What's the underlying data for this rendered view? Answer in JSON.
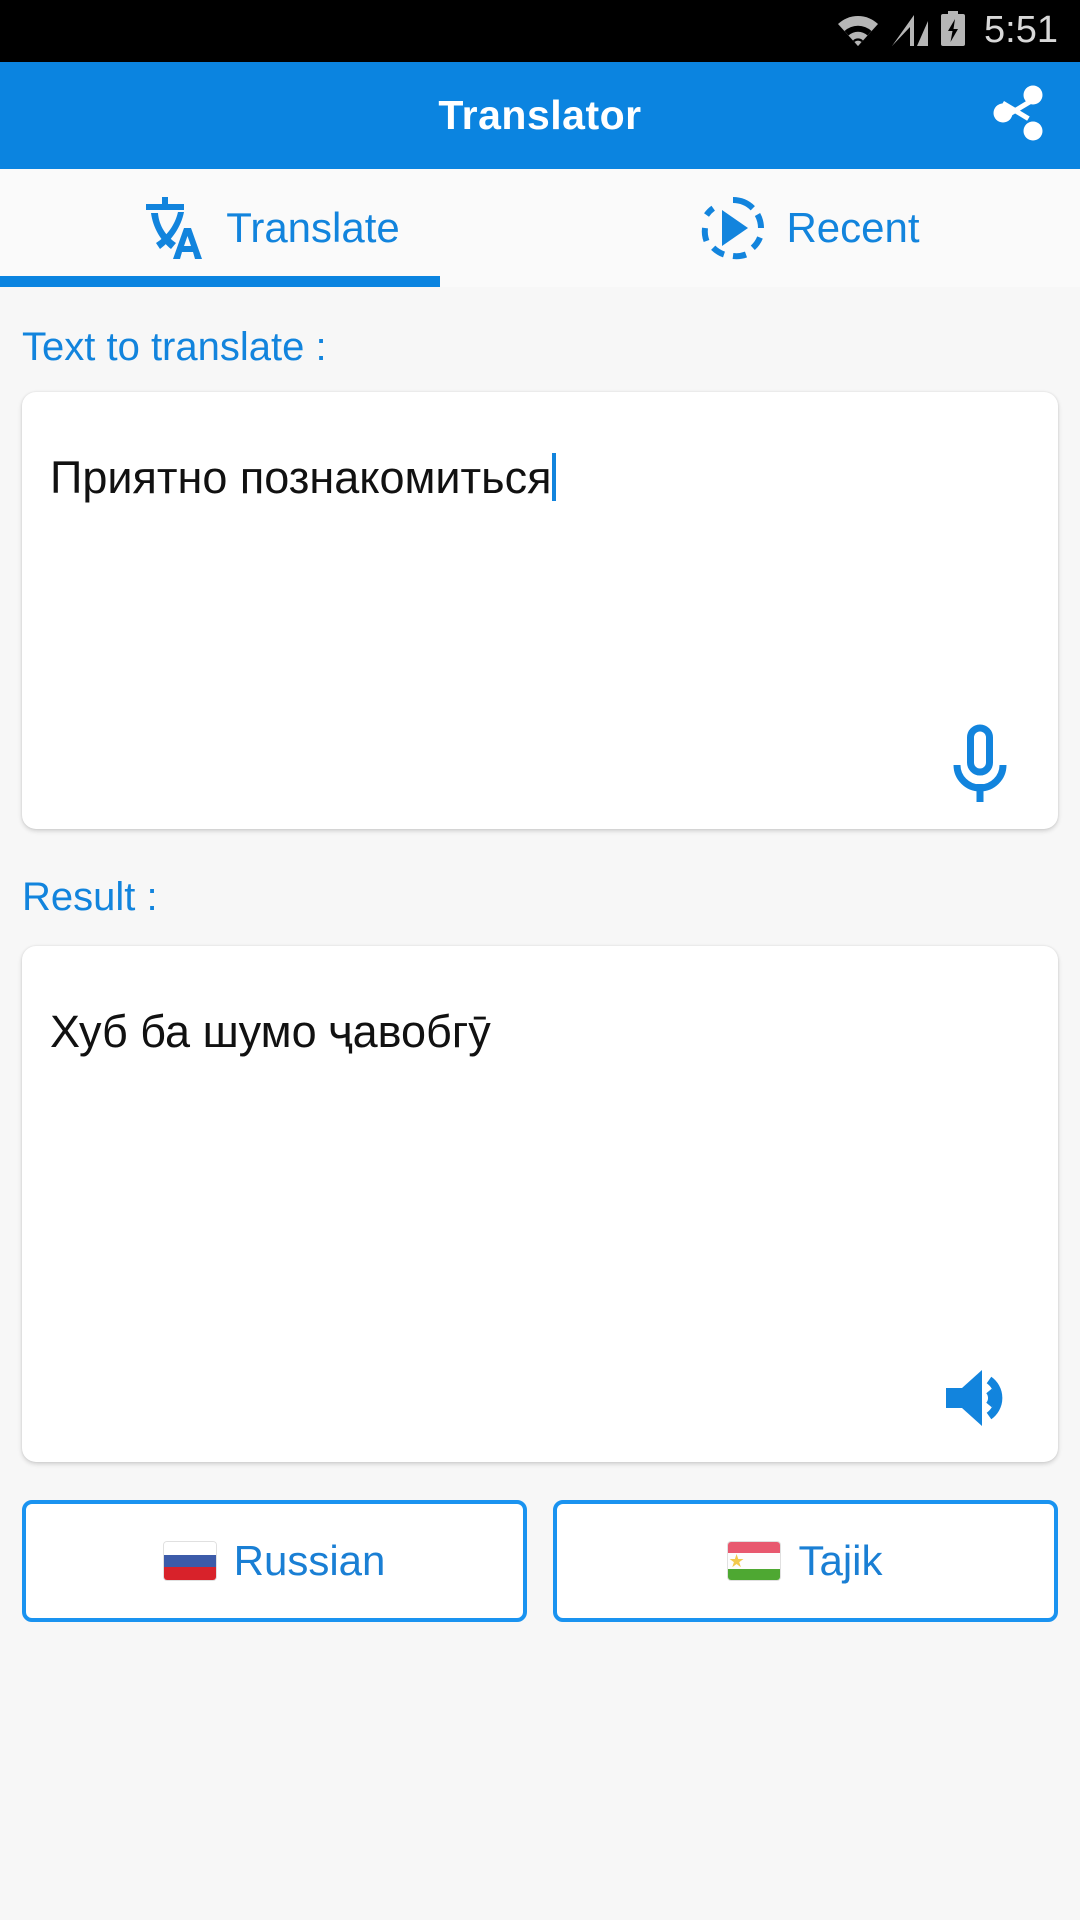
{
  "status_bar": {
    "time": "5:51",
    "icons": [
      "wifi-icon",
      "cellular-signal-icon",
      "battery-charging-icon"
    ]
  },
  "app_bar": {
    "title": "Translator",
    "share_icon": "share-icon"
  },
  "tabs": {
    "active_index": 0,
    "items": [
      {
        "label": "Translate",
        "icon": "translate-icon"
      },
      {
        "label": "Recent",
        "icon": "recent-play-icon"
      }
    ]
  },
  "input_section": {
    "label": "Text to translate :",
    "value": "Приятно познакомиться",
    "placeholder": "",
    "mic_icon": "microphone-icon"
  },
  "result_section": {
    "label": "Result :",
    "value": "Хуб ба шумо ҷавобгӯ",
    "speaker_icon": "speaker-icon"
  },
  "language_bar": {
    "source": {
      "name": "Russian",
      "flag": "russia-flag-icon"
    },
    "target": {
      "name": "Tajik",
      "flag": "tajikistan-flag-icon"
    }
  },
  "colors": {
    "accent": "#0b84e0",
    "tab_text": "#1284dd",
    "label_blue": "#1284dd",
    "status_bar_bg": "#000000",
    "page_bg": "#f7f7f7",
    "card_bg": "#ffffff",
    "text_primary": "#111111",
    "lang_border": "#1a93f0"
  }
}
